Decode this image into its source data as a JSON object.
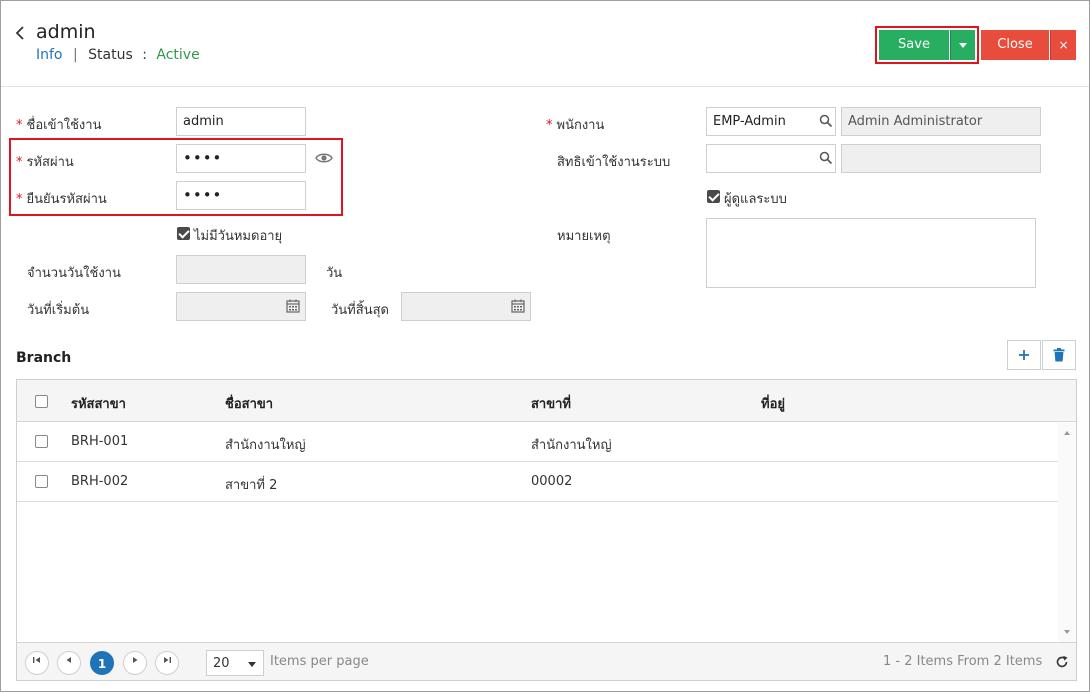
{
  "header": {
    "title": "admin",
    "info_label": "Info",
    "separator": "|",
    "status_label": "Status",
    "status_colon": ":",
    "status_value": "Active",
    "save_label": "Save",
    "close_label": "Close",
    "close_x": "×"
  },
  "form": {
    "username_label": "ชื่อเข้าใช้งาน",
    "username_value": "admin",
    "password_label": "รหัสผ่าน",
    "password_value": "••••",
    "confirm_label": "ยืนยันรหัสผ่าน",
    "confirm_value": "••••",
    "no_expiry_label": "ไม่มีวันหมดอายุ",
    "days_label": "จำนวนวันใช้งาน",
    "days_value": "",
    "days_unit": "วัน",
    "start_label": "วันที่เริ่มต้น",
    "end_label": "วันที่สิ้นสุด",
    "employee_label": "พนักงาน",
    "employee_code": "EMP-Admin",
    "employee_name": "Admin Administrator",
    "permission_label": "สิทธิเข้าใช้งานระบบ",
    "permission_value": "",
    "admin_label": "ผู้ดูแลระบบ",
    "remark_label": "หมายเหตุ",
    "remark_value": "",
    "required_mark": "*"
  },
  "branch": {
    "title": "Branch",
    "columns": [
      "รหัสสาขา",
      "ชื่อสาขา",
      "สาขาที่",
      "ที่อยู่"
    ],
    "rows": [
      {
        "code": "BRH-001",
        "name": "สำนักงานใหญ่",
        "no": "สำนักงานใหญ่",
        "address": ""
      },
      {
        "code": "BRH-002",
        "name": "สาขาที่ 2",
        "no": "00002",
        "address": ""
      }
    ],
    "pager": {
      "current_page": "1",
      "page_size": "20",
      "items_per_page": "Items per page",
      "summary": "1 - 2 Items From 2 Items"
    }
  },
  "colors": {
    "save": "#27ae60",
    "close": "#e74c3c",
    "link": "#1f74b9",
    "active": "#2e9a48",
    "highlight": "#e0141e"
  },
  "icons": [
    "chevron-left-icon",
    "caret-down-icon",
    "close-icon",
    "eye-icon",
    "search-icon",
    "calendar-icon",
    "plus-icon",
    "trash-icon",
    "first-page-icon",
    "prev-page-icon",
    "next-page-icon",
    "last-page-icon",
    "refresh-icon"
  ]
}
